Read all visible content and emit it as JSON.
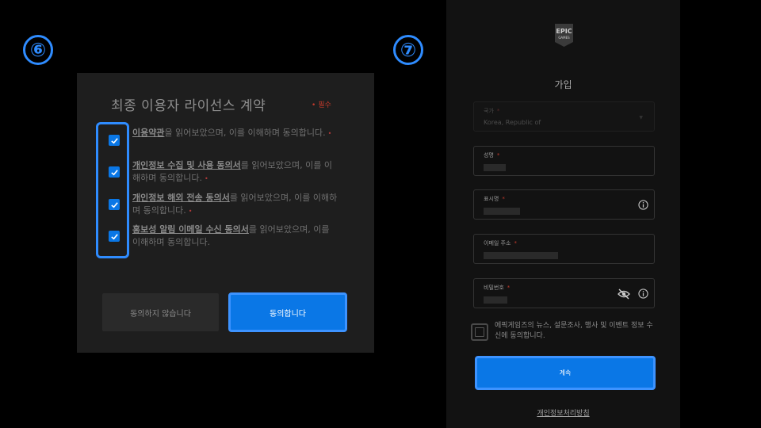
{
  "steps": {
    "step6": "⑥",
    "step7": "⑦"
  },
  "eula": {
    "title": "최종 이용자 라이선스 계약",
    "required_marker": "•",
    "required_label": "필수",
    "items": [
      {
        "link": "이용약관",
        "text": "을 읽어보았으며, 이를 이해하며 동의합니다.",
        "checked": true,
        "required_marker": "•"
      },
      {
        "link": "개인정보 수집 및 사용 동의서",
        "text": "를 읽어보았으며, 이를 이해하며 동의합니다.",
        "checked": true,
        "required_marker": "•"
      },
      {
        "link": "개인정보 해외 전송 동의서",
        "text": "를 읽어보았으며, 이를 이해하며 동의합니다.",
        "checked": true,
        "required_marker": "•"
      },
      {
        "link": "홍보성 알림 이메일 수신 동의서",
        "text": "를 읽어보았으며, 이를 이해하며 동의합니다.",
        "checked": true,
        "required_marker": ""
      }
    ],
    "decline_label": "동의하지 않습니다",
    "accept_label": "동의합니다"
  },
  "signup": {
    "logo_text_top": "EPIC",
    "logo_text_bottom": "GAMES",
    "title": "가입",
    "fields": {
      "country": {
        "label": "국가",
        "required": "*",
        "value": "Korea, Republic of"
      },
      "name": {
        "label": "성명",
        "required": "*"
      },
      "display_name": {
        "label": "표시명",
        "required": "*"
      },
      "email": {
        "label": "이메일 주소",
        "required": "*"
      },
      "password": {
        "label": "비밀번호",
        "required": "*"
      }
    },
    "news_consent": "에픽게임즈의 뉴스, 설문조사, 행사 및 이벤트 정보 수신에 동의합니다.",
    "news_checked": false,
    "continue_label": "계속",
    "privacy_link": "개인정보처리방침"
  },
  "colors": {
    "accent": "#0a77e6",
    "highlight": "#2f8cff",
    "required": "#c0392b"
  },
  "icons": [
    "checkbox-checked-icon",
    "info-icon",
    "eye-off-icon",
    "epic-games-logo",
    "chevron-down-icon"
  ]
}
